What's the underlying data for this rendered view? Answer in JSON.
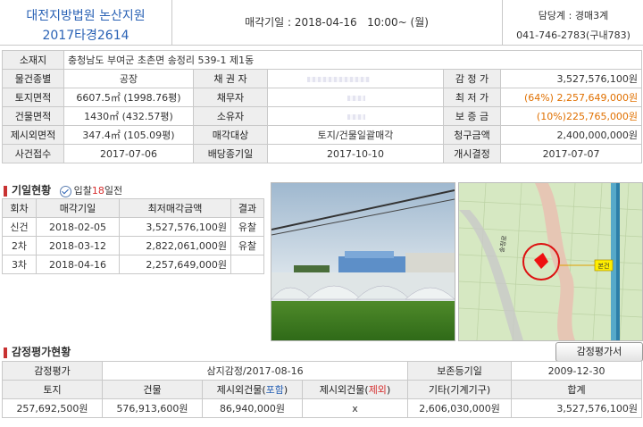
{
  "header": {
    "court": "대전지방법원 논산지원",
    "case_no": "2017타경2614",
    "sale_date_label": "매각기일 : 2018-04-16   10:00~ (월)",
    "dept": "담당계 : 경매3계",
    "phone": "041-746-2783(구내783)"
  },
  "info": {
    "address_label": "소재지",
    "address": "충청남도 부여군 초촌면 송정리 539-1 제1동",
    "type_label": "물건종별",
    "type": "공장",
    "creditor_label": "채 권 자",
    "creditor": "",
    "appraisal_label": "감 정 가",
    "appraisal": "3,527,576,100원",
    "land_label": "토지면적",
    "land": "6607.5㎡ (1998.76평)",
    "debtor_label": "채무자",
    "debtor": "",
    "min_price_label": "최 저 가",
    "min_price": "(64%) 2,257,649,000원",
    "bldg_label": "건물면적",
    "bldg": "1430㎡ (432.57평)",
    "owner_label": "소유자",
    "owner": "",
    "deposit_label": "보 증 금",
    "deposit": "(10%)225,765,000원",
    "excl_label": "제시외면적",
    "excl": "347.4㎡ (105.09평)",
    "sale_target_label": "매각대상",
    "sale_target": "토지/건물일괄매각",
    "claim_label": "청구금액",
    "claim": "2,400,000,000원",
    "receipt_label": "사건접수",
    "receipt": "2017-07-06",
    "dividend_label": "배당종기일",
    "dividend": "2017-10-10",
    "start_label": "개시결정",
    "start": "2017-07-07"
  },
  "history": {
    "title": "기일현황",
    "bid_prefix": "입찰",
    "bid_days": "18",
    "bid_suffix": "일전",
    "headers": [
      "회차",
      "매각기일",
      "최저매각금액",
      "결과"
    ],
    "rows": [
      {
        "round": "신건",
        "date": "2018-02-05",
        "price": "3,527,576,100원",
        "result": "유찰"
      },
      {
        "round": "2차",
        "date": "2018-03-12",
        "price": "2,822,061,000원",
        "result": "유찰"
      },
      {
        "round": "3차",
        "date": "2018-04-16",
        "price": "2,257,649,000원",
        "result": ""
      }
    ]
  },
  "map": {
    "marker_label": "본건",
    "road_label": "송정로"
  },
  "appraisal": {
    "title": "감정평가현황",
    "button": "감정평가서",
    "row1": {
      "label": "감정평가",
      "agency": "삼지감정/2017-08-16",
      "keep_label": "보존등기일",
      "keep_date": "2009-12-30"
    },
    "headers": {
      "land": "토지",
      "bldg": "건물",
      "incl_prefix": "제시외건물(",
      "incl_word": "포함",
      "excl_prefix": "제시외건물(",
      "excl_word": "제외",
      "suffix": ")",
      "other": "기타(기계기구)",
      "total": "합계"
    },
    "values": {
      "land": "257,692,500원",
      "bldg": "576,913,600원",
      "incl": "86,940,000원",
      "excl": "x",
      "other": "2,606,030,000원",
      "total": "3,527,576,100원"
    }
  },
  "colors": {
    "title_blue": "#2a62b5",
    "label_bg": "#eeeeee",
    "accent_red": "#d63030",
    "min_price_orange": "#e07000"
  }
}
